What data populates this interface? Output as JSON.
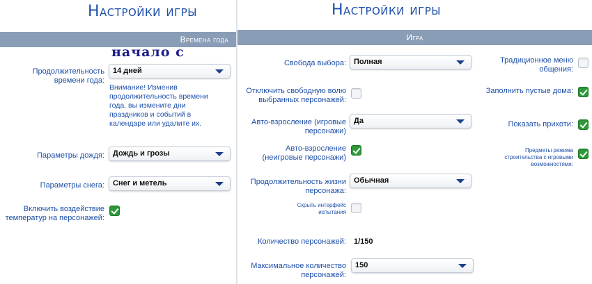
{
  "left": {
    "title": "Настройки игры",
    "section": "Времена года",
    "overlay_text": "начало с весны",
    "season_length": {
      "label": "Продолжительность времени года:",
      "value": "14 дней",
      "note": "Внимание! Изменив продолжительность времени года, вы измените дни праздников и событий в календаре или удалите их."
    },
    "rain": {
      "label": "Параметры дождя:",
      "value": "Дождь и грозы"
    },
    "snow": {
      "label": "Параметры снега:",
      "value": "Снег и метель"
    },
    "temperature": {
      "label": "Включить воздействие температур на персонажей:",
      "checked": true
    }
  },
  "right": {
    "title": "Настройки игры",
    "section": "Игра",
    "free_will": {
      "label": "Свобода выбора:",
      "value": "Полная"
    },
    "disable_free_will": {
      "label": "Отключить свободную волю выбранных персонажей:",
      "checked": false
    },
    "auto_age_played": {
      "label": "Авто-взросление (игровые персонажи)",
      "value": "Да"
    },
    "auto_age_unplayed": {
      "label": "Авто-взросление (неигровые персонажи)",
      "checked": true
    },
    "lifespan": {
      "label": "Продолжительность жизни персонажа:",
      "value": "Обычная"
    },
    "hide_trials": {
      "label": "Скрыть интерфейс испытания",
      "checked": false
    },
    "sim_count": {
      "label": "Количество персонажей:",
      "value": "1/150"
    },
    "max_sims": {
      "label": "Максимальное количество персонажей:",
      "value": "150"
    },
    "classic_menu": {
      "label": "Традиционное меню общения:",
      "checked": false
    },
    "fill_empty_homes": {
      "label": "Заполнить пустые дома:",
      "checked": true
    },
    "show_whims": {
      "label": "Показать прихоти:",
      "checked": true
    },
    "build_items": {
      "label": "Предметы режима строительства с игровыми возможностями:",
      "checked": true
    }
  }
}
